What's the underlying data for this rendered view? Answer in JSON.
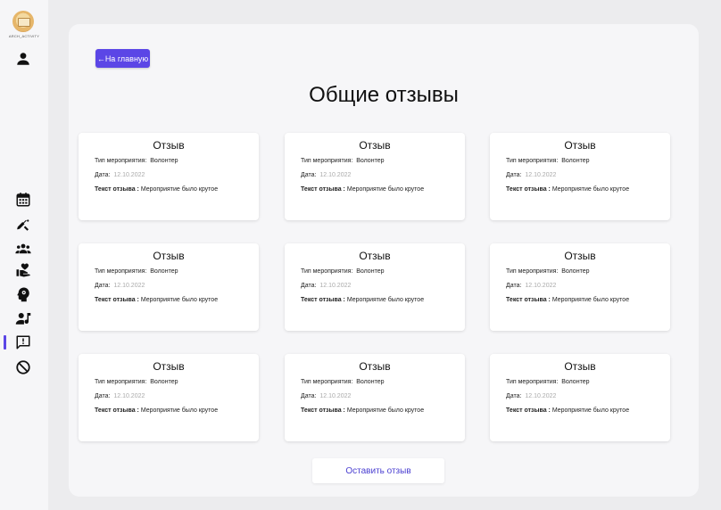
{
  "sidebar": {
    "logo_caption": "ARCH_ACTIVITY",
    "icons": [
      {
        "name": "profile-icon"
      },
      {
        "name": "calendar-icon"
      },
      {
        "name": "cleaning-icon"
      },
      {
        "name": "group-icon"
      },
      {
        "name": "volunteer-icon"
      },
      {
        "name": "psychology-icon"
      },
      {
        "name": "person-music-icon"
      },
      {
        "name": "feedback-icon",
        "active": true
      },
      {
        "name": "block-icon"
      }
    ],
    "accent_color": "#5b46e6"
  },
  "header": {
    "back_label": "←На главную",
    "title": "Общие отзывы"
  },
  "reviews": [
    {
      "title": "Отзыв",
      "type_label": "Тип мероприятия:",
      "type_value": "Волонтер",
      "date_label": "Дата:",
      "date_value": "12.10.2022",
      "text_label": "Текст отзыва :",
      "text_value": "Мероприятие было крутое"
    },
    {
      "title": "Отзыв",
      "type_label": "Тип мероприятия:",
      "type_value": "Волонтер",
      "date_label": "Дата:",
      "date_value": "12.10.2022",
      "text_label": "Текст отзыва :",
      "text_value": "Мероприятие было крутое"
    },
    {
      "title": "Отзыв",
      "type_label": "Тип мероприятия:",
      "type_value": "Волонтер",
      "date_label": "Дата:",
      "date_value": "12.10.2022",
      "text_label": "Текст отзыва :",
      "text_value": "Мероприятие было крутое"
    },
    {
      "title": "Отзыв",
      "type_label": "Тип мероприятия:",
      "type_value": "Волонтер",
      "date_label": "Дата:",
      "date_value": "12.10.2022",
      "text_label": "Текст отзыва :",
      "text_value": "Мероприятие было крутое"
    },
    {
      "title": "Отзыв",
      "type_label": "Тип мероприятия:",
      "type_value": "Волонтер",
      "date_label": "Дата:",
      "date_value": "12.10.2022",
      "text_label": "Текст отзыва :",
      "text_value": "Мероприятие было крутое"
    },
    {
      "title": "Отзыв",
      "type_label": "Тип мероприятия:",
      "type_value": "Волонтер",
      "date_label": "Дата:",
      "date_value": "12.10.2022",
      "text_label": "Текст отзыва :",
      "text_value": "Мероприятие было крутое"
    },
    {
      "title": "Отзыв",
      "type_label": "Тип мероприятия:",
      "type_value": "Волонтер",
      "date_label": "Дата:",
      "date_value": "12.10.2022",
      "text_label": "Текст отзыва :",
      "text_value": "Мероприятие было крутое"
    },
    {
      "title": "Отзыв",
      "type_label": "Тип мероприятия:",
      "type_value": "Волонтер",
      "date_label": "Дата:",
      "date_value": "12.10.2022",
      "text_label": "Текст отзыва :",
      "text_value": "Мероприятие было крутое"
    },
    {
      "title": "Отзыв",
      "type_label": "Тип мероприятия:",
      "type_value": "Волонтер",
      "date_label": "Дата:",
      "date_value": "12.10.2022",
      "text_label": "Текст отзыва :",
      "text_value": "Мероприятие было крутое"
    }
  ],
  "footer": {
    "leave_review_label": "Оставить отзыв"
  }
}
